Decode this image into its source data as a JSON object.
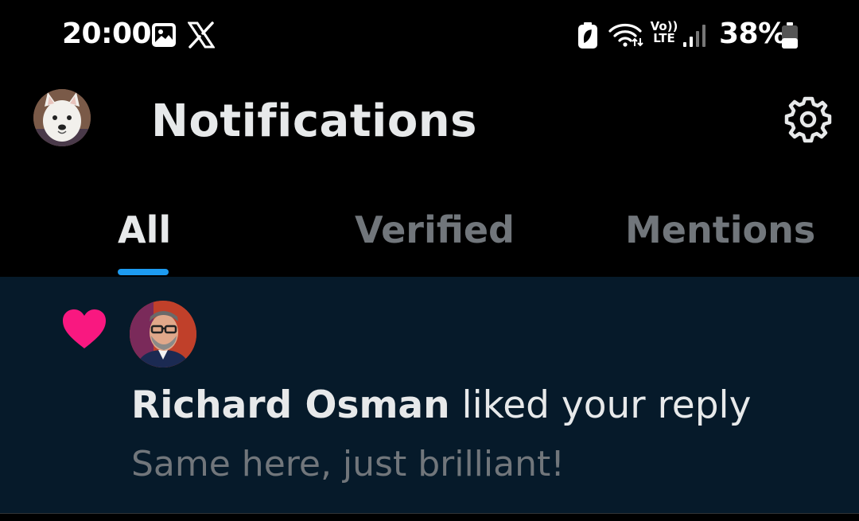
{
  "status_bar": {
    "time": "20:00",
    "battery_percent": "38%",
    "icons": [
      "gallery-icon",
      "x-logo-icon",
      "battery-saver-icon",
      "wifi-icon",
      "volte-icon",
      "signal-icon",
      "battery-icon"
    ],
    "volte_label_top": "Vo))",
    "volte_label_bottom": "LTE"
  },
  "header": {
    "title": "Notifications",
    "avatar": "profile-avatar-dog",
    "settings_icon": "gear-icon"
  },
  "tabs": [
    {
      "label": "All",
      "active": true
    },
    {
      "label": "Verified",
      "active": false
    },
    {
      "label": "Mentions",
      "active": false
    }
  ],
  "notifications": [
    {
      "type_icon": "heart-icon",
      "actor_name": "Richard Osman",
      "action": " liked your reply",
      "snippet": "Same here, just brilliant!"
    }
  ],
  "colors": {
    "background": "#000000",
    "notification_bg": "#061a2a",
    "accent": "#1d9bf0",
    "heart": "#f91880",
    "muted_text": "#71767b",
    "primary_text": "#e7e9ea"
  }
}
